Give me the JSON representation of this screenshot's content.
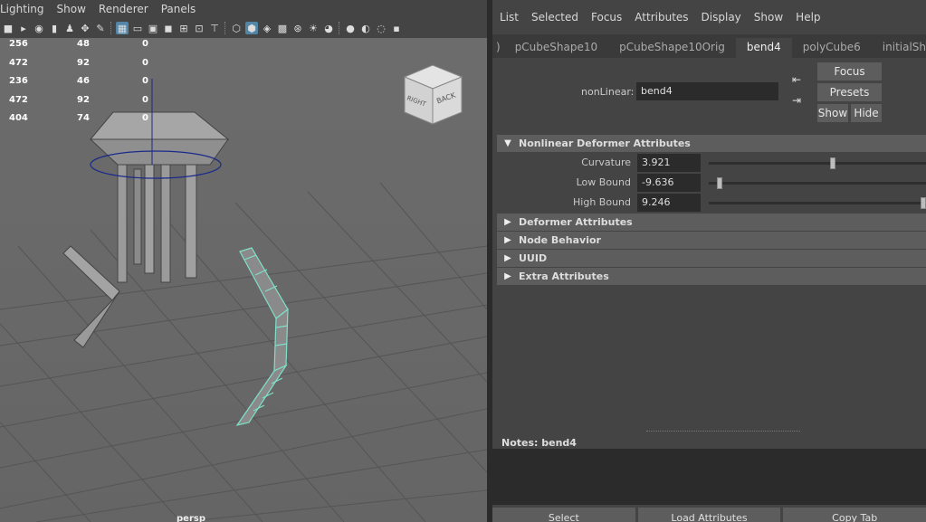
{
  "viewport": {
    "menu": [
      "Lighting",
      "Show",
      "Renderer",
      "Panels"
    ],
    "toolbar_icons": [
      "camera-icon",
      "bookmark-camera-icon",
      "camera-attrs-icon",
      "bookmark-icon",
      "image-plane-icon",
      "pan-icon",
      "pencil-icon",
      "grid-icon",
      "film-gate-icon",
      "resolution-gate-icon",
      "gate-mask-icon",
      "field-chart-icon",
      "safe-action-icon",
      "safe-title-icon",
      "wireframe-icon",
      "smooth-shade-icon",
      "wireframe-on-shaded-icon",
      "textured-icon",
      "use-lights-icon",
      "shadows-icon",
      "ambient-occlusion-icon",
      "motion-blur-icon",
      "antialiasing-icon",
      "isolate-select-icon",
      "xray-icon"
    ],
    "hud": [
      [
        "256",
        "48",
        "0"
      ],
      [
        "472",
        "92",
        "0"
      ],
      [
        "236",
        "46",
        "0"
      ],
      [
        "472",
        "92",
        "0"
      ],
      [
        "404",
        "74",
        "0"
      ]
    ],
    "viewcube": {
      "right": "RIGHT",
      "back": "BACK"
    },
    "camera": "persp"
  },
  "ae": {
    "menu": [
      "List",
      "Selected",
      "Focus",
      "Attributes",
      "Display",
      "Show",
      "Help"
    ],
    "tabs_left_arrow": ")",
    "tabs": [
      "pCubeShape10",
      "pCubeShape10Orig",
      "bend4",
      "polyCube6",
      "initialShadingGroup"
    ],
    "active_tab": "bend4",
    "node_type_label": "nonLinear:",
    "node_name": "bend4",
    "buttons": {
      "focus": "Focus",
      "presets": "Presets",
      "show": "Show",
      "hide": "Hide"
    },
    "sections": {
      "nonlinear": "Nonlinear Deformer Attributes",
      "deformer": "Deformer Attributes",
      "node_behavior": "Node Behavior",
      "uuid": "UUID",
      "extra": "Extra Attributes"
    },
    "attributes": [
      {
        "label": "Curvature",
        "value": "3.921",
        "slider_fraction": 0.57
      },
      {
        "label": "Low Bound",
        "value": "-9.636",
        "slider_fraction": 0.05
      },
      {
        "label": "High Bound",
        "value": "9.246",
        "slider_fraction": 1.0
      }
    ],
    "notes_label": "Notes:  bend4",
    "bottom_buttons": [
      "Select",
      "Load Attributes",
      "Copy Tab"
    ]
  }
}
